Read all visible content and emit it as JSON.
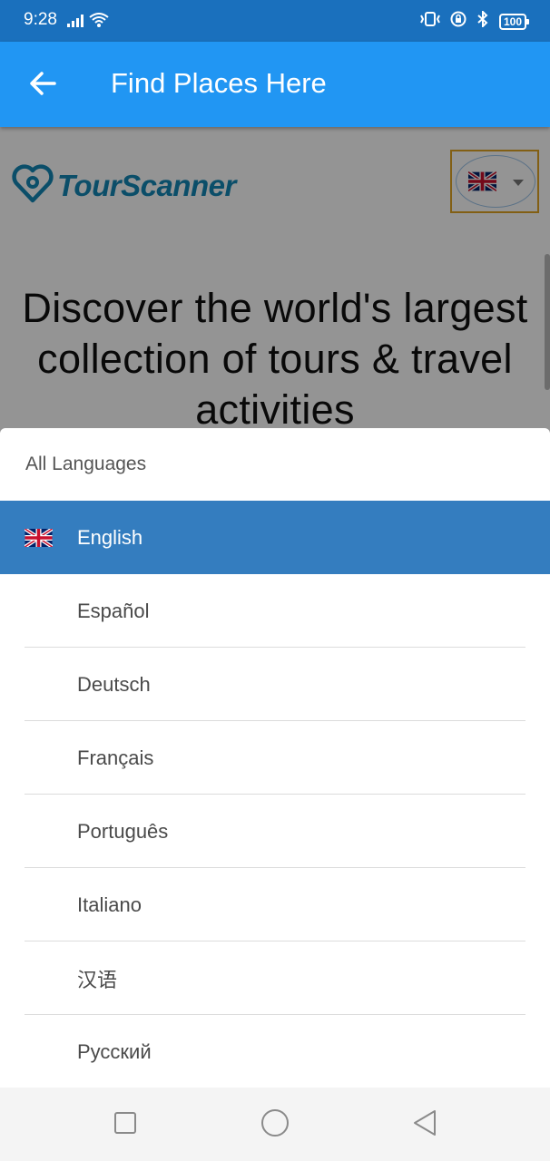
{
  "status_bar": {
    "time": "9:28",
    "battery": "100",
    "icons": [
      "signal-icon",
      "wifi-icon",
      "vibrate-icon",
      "lock-rotation-icon",
      "bluetooth-icon",
      "battery-icon"
    ]
  },
  "app_bar": {
    "title": "Find Places Here",
    "back_icon": "arrow-left-icon",
    "color": "#2196f3"
  },
  "page": {
    "logo_text": "TourScanner",
    "hero_text": "Discover the world's largest collection of tours & travel activities",
    "language_selector": {
      "selected_flag": "uk-flag-icon"
    }
  },
  "language_sheet": {
    "header": "All Languages",
    "items": [
      {
        "label": "English",
        "selected": true,
        "flag": "uk-flag-icon"
      },
      {
        "label": "Español"
      },
      {
        "label": "Deutsch"
      },
      {
        "label": "Français"
      },
      {
        "label": "Português"
      },
      {
        "label": "Italiano"
      },
      {
        "label": "汉语"
      },
      {
        "label": "Русский"
      }
    ],
    "selected_color": "#347dbf"
  },
  "nav_bar": {
    "buttons": [
      "recents-square-icon",
      "home-circle-icon",
      "back-triangle-icon"
    ]
  }
}
